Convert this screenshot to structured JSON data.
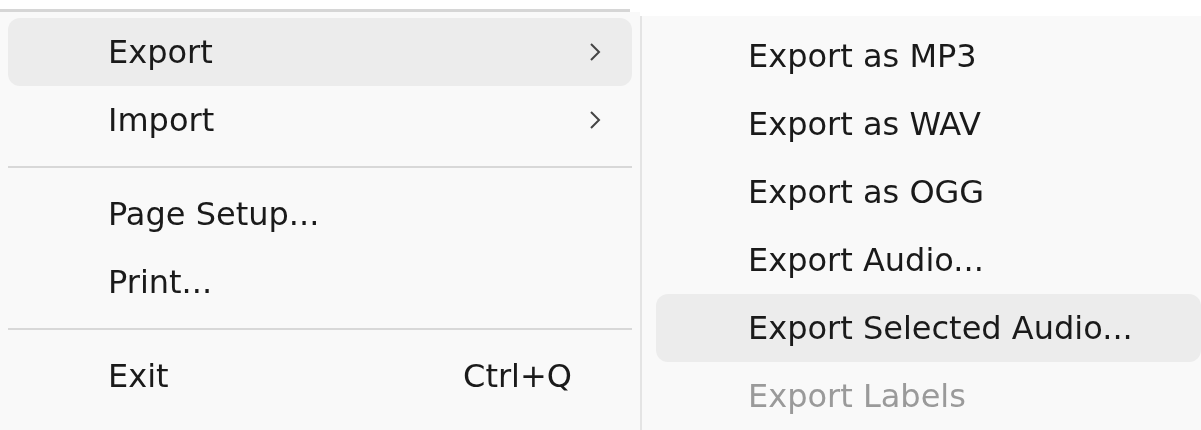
{
  "file_menu": {
    "items": [
      {
        "kind": "item",
        "label": "Export",
        "submenu": true,
        "selected": true
      },
      {
        "kind": "item",
        "label": "Import",
        "submenu": true,
        "selected": false
      },
      {
        "kind": "separator"
      },
      {
        "kind": "item",
        "label": "Page Setup...",
        "submenu": false,
        "selected": false
      },
      {
        "kind": "item",
        "label": "Print...",
        "submenu": false,
        "selected": false
      },
      {
        "kind": "separator"
      },
      {
        "kind": "item",
        "label": "Exit",
        "shortcut": "Ctrl+Q",
        "submenu": false,
        "selected": false
      }
    ]
  },
  "export_submenu": {
    "items": [
      {
        "label": "Export as MP3",
        "selected": false,
        "disabled": false
      },
      {
        "label": "Export as WAV",
        "selected": false,
        "disabled": false
      },
      {
        "label": "Export as OGG",
        "selected": false,
        "disabled": false
      },
      {
        "label": "Export Audio...",
        "selected": false,
        "disabled": false
      },
      {
        "label": "Export Selected Audio...",
        "selected": true,
        "disabled": false
      },
      {
        "label": "Export Labels",
        "selected": false,
        "disabled": true
      }
    ]
  }
}
